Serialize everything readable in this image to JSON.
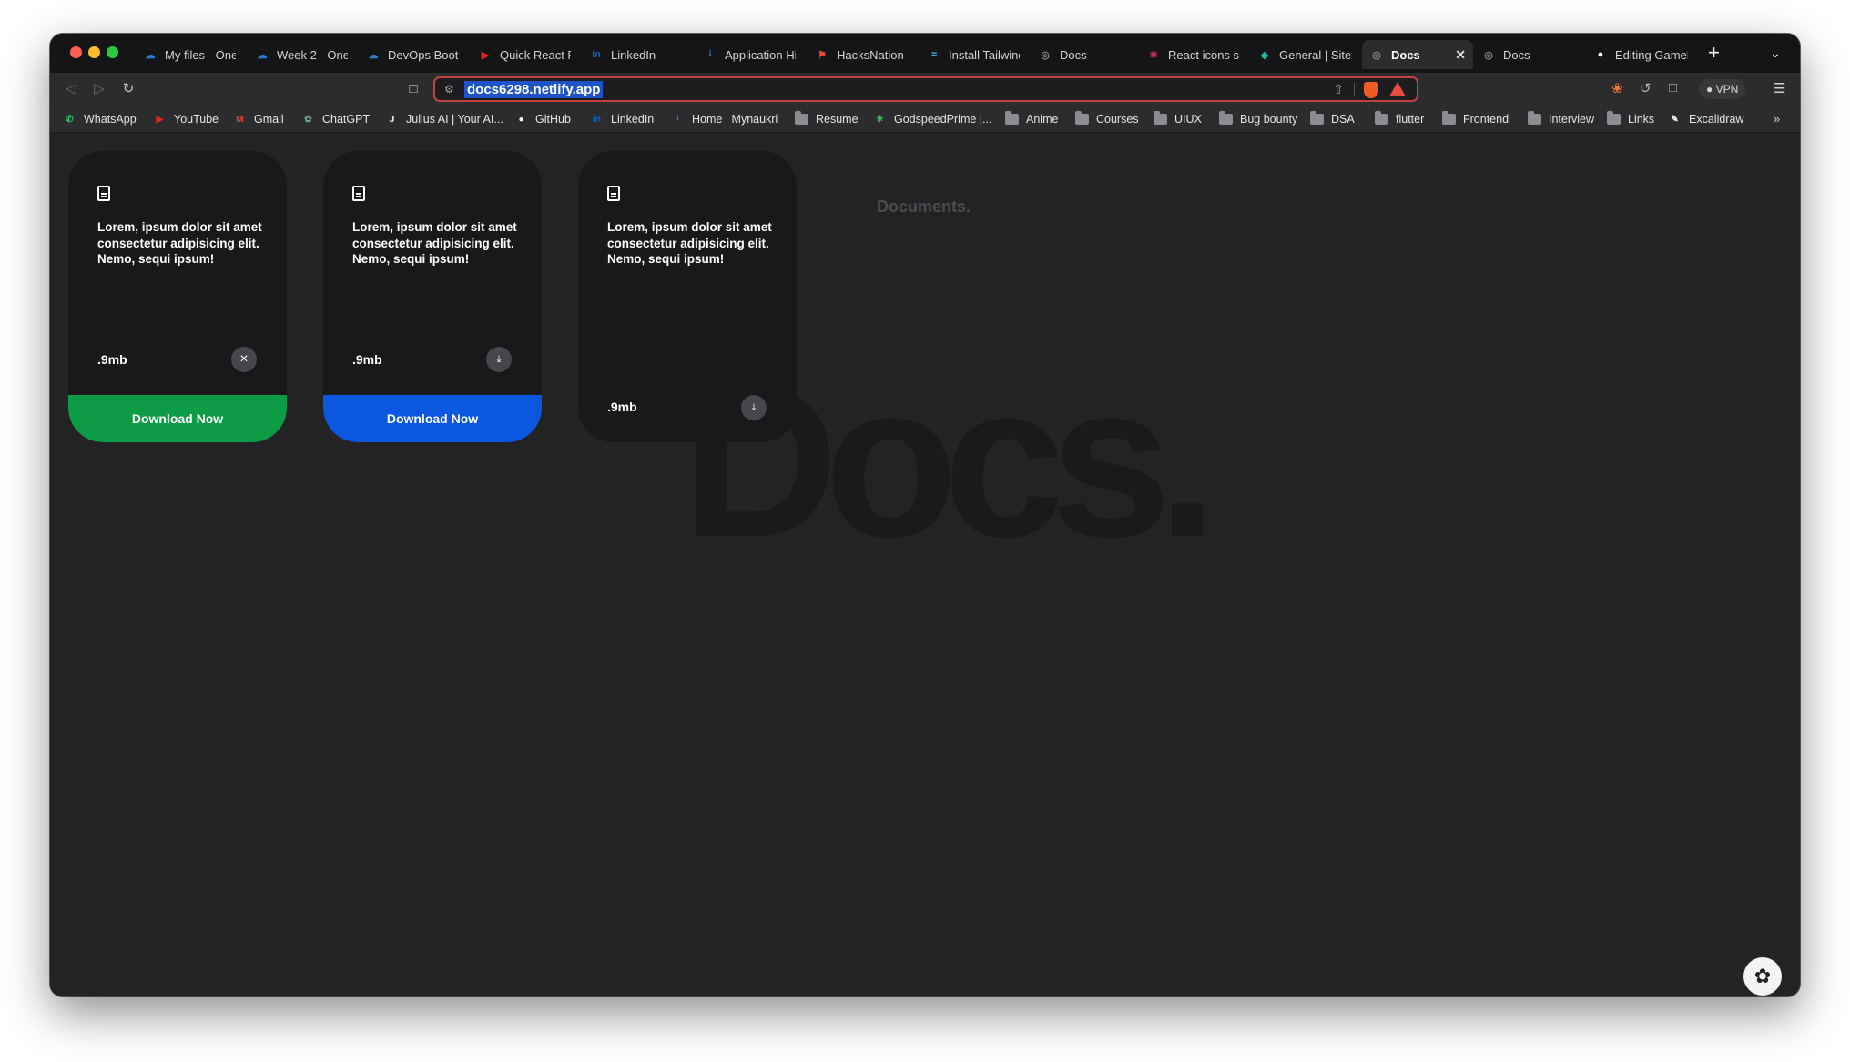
{
  "browser": {
    "tabs": [
      {
        "title": "My files - OneD",
        "icon": "onedrive-icon",
        "color": "#2b7cd3"
      },
      {
        "title": "Week 2 - OneD",
        "icon": "onedrive-icon",
        "color": "#2b7cd3"
      },
      {
        "title": "DevOps Bootca",
        "icon": "onedrive-icon",
        "color": "#2b7cd3"
      },
      {
        "title": "Quick React Pr",
        "icon": "youtube-icon",
        "color": "#e62117"
      },
      {
        "title": "LinkedIn",
        "icon": "linkedin-icon",
        "color": "#0a66c2"
      },
      {
        "title": "Application His",
        "icon": "mynaukri-icon",
        "color": "#3f7fd8"
      },
      {
        "title": "HacksNation -",
        "icon": "hacksnation-icon",
        "color": "#e4493b"
      },
      {
        "title": "Install Tailwind",
        "icon": "tailwind-icon",
        "color": "#38bdf8"
      },
      {
        "title": "Docs",
        "icon": "globe-icon",
        "color": "#8a8a8e"
      },
      {
        "title": "React icons se",
        "icon": "react-icons-icon",
        "color": "#e6355f"
      },
      {
        "title": "General | Site c",
        "icon": "netlify-icon",
        "color": "#20b3a2"
      },
      {
        "title": "Docs",
        "icon": "globe-icon",
        "color": "#8a8a8e",
        "active": true
      },
      {
        "title": "Docs",
        "icon": "globe-icon",
        "color": "#8a8a8e"
      },
      {
        "title": "Editing GameF",
        "icon": "github-icon",
        "color": "#ffffff"
      }
    ],
    "url": "docs6298.netlify.app",
    "vpn_label": "VPN"
  },
  "bookmarks": [
    {
      "label": "WhatsApp",
      "type": "site",
      "icon": "whatsapp-icon",
      "color": "#25d366"
    },
    {
      "label": "YouTube",
      "type": "site",
      "icon": "youtube-icon",
      "color": "#e62117"
    },
    {
      "label": "Gmail",
      "type": "site",
      "icon": "gmail-icon",
      "color": "#ea4335"
    },
    {
      "label": "ChatGPT",
      "type": "site",
      "icon": "chatgpt-icon",
      "color": "#74aa9c"
    },
    {
      "label": "Julius AI | Your AI...",
      "type": "site",
      "icon": "julius-icon",
      "color": "#ffffff"
    },
    {
      "label": "GitHub",
      "type": "site",
      "icon": "github-icon",
      "color": "#ffffff"
    },
    {
      "label": "LinkedIn",
      "type": "site",
      "icon": "linkedin-icon",
      "color": "#0a66c2"
    },
    {
      "label": "Home | Mynaukri",
      "type": "site",
      "icon": "mynaukri-icon",
      "color": "#3f7fd8"
    },
    {
      "label": "Resume",
      "type": "folder"
    },
    {
      "label": "GodspeedPrime |...",
      "type": "site",
      "icon": "godspeed-icon",
      "color": "#2fcf56"
    },
    {
      "label": "Anime",
      "type": "folder"
    },
    {
      "label": "Courses",
      "type": "folder"
    },
    {
      "label": "UIUX",
      "type": "folder"
    },
    {
      "label": "Bug bounty",
      "type": "folder"
    },
    {
      "label": "DSA",
      "type": "folder"
    },
    {
      "label": "flutter",
      "type": "folder"
    },
    {
      "label": "Frontend",
      "type": "folder"
    },
    {
      "label": "Interview",
      "type": "folder"
    },
    {
      "label": "Links",
      "type": "folder"
    },
    {
      "label": "Excalidraw",
      "type": "site",
      "icon": "excalidraw-icon",
      "color": "#ffffff"
    }
  ],
  "page": {
    "background_title": "Docs.",
    "caption": "Documents.",
    "cards": [
      {
        "text": "Lorem, ipsum dolor sit amet consectetur adipisicing elit. Nemo, sequi ipsum!",
        "size": ".9mb",
        "action": "close",
        "cta": "Download Now",
        "cta_color": "#0d9b46"
      },
      {
        "text": "Lorem, ipsum dolor sit amet consectetur adipisicing elit. Nemo, sequi ipsum!",
        "size": ".9mb",
        "action": "download",
        "cta": "Download Now",
        "cta_color": "#0b57e0"
      },
      {
        "text": "Lorem, ipsum dolor sit amet consectetur adipisicing elit. Nemo, sequi ipsum!",
        "size": ".9mb",
        "action": "download",
        "cta": "",
        "cta_color": ""
      }
    ]
  }
}
